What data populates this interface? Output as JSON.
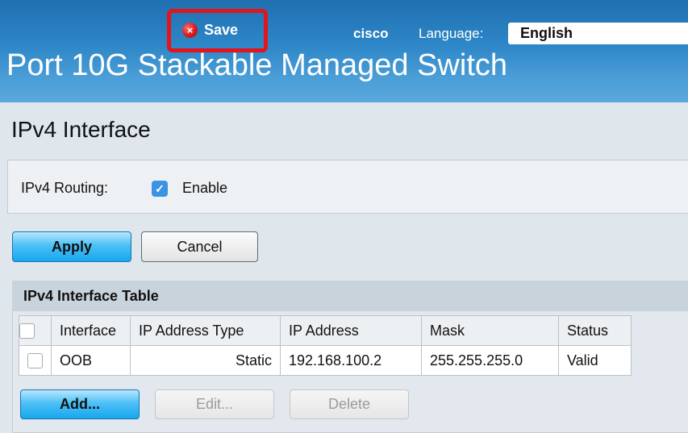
{
  "header": {
    "save_label": "Save",
    "brand": "cisco",
    "language_label": "Language:",
    "language_value": "English",
    "product_title": "Port 10G Stackable Managed Switch"
  },
  "page": {
    "title": "IPv4 Interface"
  },
  "routing": {
    "label": "IPv4 Routing:",
    "enable_label": "Enable",
    "enabled": true
  },
  "form_buttons": {
    "apply": "Apply",
    "cancel": "Cancel"
  },
  "table": {
    "caption": "IPv4 Interface Table",
    "columns": [
      "Interface",
      "IP Address Type",
      "IP Address",
      "Mask",
      "Status"
    ],
    "rows": [
      {
        "interface": "OOB",
        "ip_address_type": "Static",
        "ip_address": "192.168.100.2",
        "mask": "255.255.255.0",
        "status": "Valid"
      }
    ],
    "buttons": {
      "add": "Add...",
      "edit": "Edit...",
      "delete": "Delete"
    }
  },
  "icons": {
    "save": "close-circle-icon",
    "checkbox": "checkmark-icon"
  },
  "colors": {
    "header_blue": "#2e87c8",
    "highlight_red": "#e3141b",
    "primary_button": "#17a7ee",
    "checkbox_blue": "#3b93e3"
  }
}
